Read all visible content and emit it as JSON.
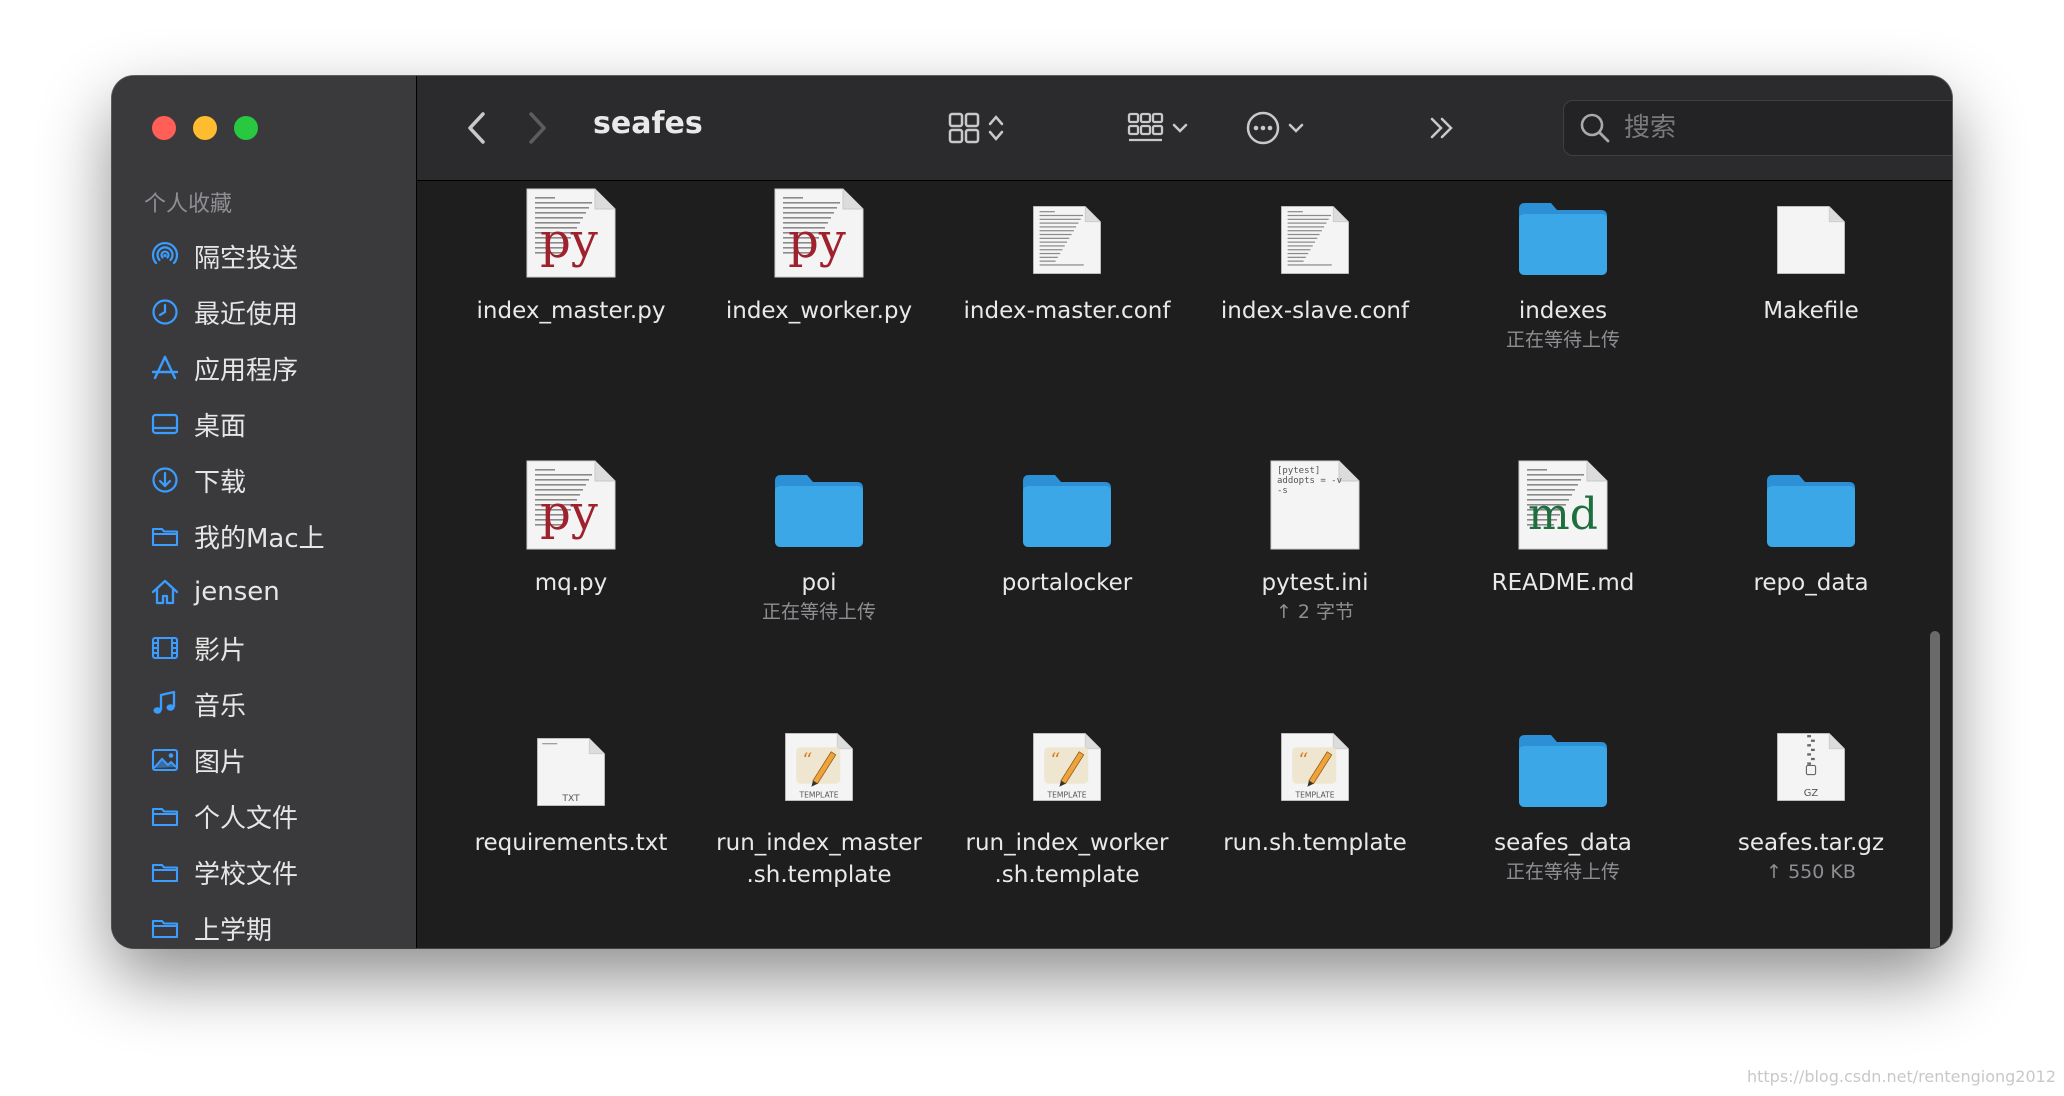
{
  "window": {
    "title": "seafes"
  },
  "sidebar": {
    "section": "个人收藏",
    "items": [
      {
        "label": "隔空投送",
        "icon": "airdrop-icon"
      },
      {
        "label": "最近使用",
        "icon": "clock-icon"
      },
      {
        "label": "应用程序",
        "icon": "applications-icon"
      },
      {
        "label": "桌面",
        "icon": "desktop-icon"
      },
      {
        "label": "下载",
        "icon": "download-icon"
      },
      {
        "label": "我的Mac上",
        "icon": "folder-icon"
      },
      {
        "label": "jensen",
        "icon": "home-icon"
      },
      {
        "label": "影片",
        "icon": "film-icon"
      },
      {
        "label": "音乐",
        "icon": "music-icon"
      },
      {
        "label": "图片",
        "icon": "photo-icon"
      },
      {
        "label": "个人文件",
        "icon": "folder-icon"
      },
      {
        "label": "学校文件",
        "icon": "folder-icon"
      },
      {
        "label": "上学期",
        "icon": "folder-icon"
      }
    ]
  },
  "toolbar": {
    "search_placeholder": "搜索"
  },
  "files": [
    {
      "name": "index_master.py",
      "sub": "",
      "type": "py"
    },
    {
      "name": "index_worker.py",
      "sub": "",
      "type": "py"
    },
    {
      "name": "index-master.conf",
      "sub": "",
      "type": "text"
    },
    {
      "name": "index-slave.conf",
      "sub": "",
      "type": "text"
    },
    {
      "name": "indexes",
      "sub": "正在等待上传",
      "type": "folder"
    },
    {
      "name": "Makefile",
      "sub": "",
      "type": "blank"
    },
    {
      "name": "mq.py",
      "sub": "",
      "type": "py"
    },
    {
      "name": "poi",
      "sub": "正在等待上传",
      "type": "folder"
    },
    {
      "name": "portalocker",
      "sub": "",
      "type": "folder"
    },
    {
      "name": "pytest.ini",
      "sub": "↑ 2 字节",
      "type": "ini"
    },
    {
      "name": "README.md",
      "sub": "",
      "type": "md"
    },
    {
      "name": "repo_data",
      "sub": "",
      "type": "folder"
    },
    {
      "name": "requirements.txt",
      "sub": "",
      "type": "txt"
    },
    {
      "name": "run_index_master\n.sh.template",
      "sub": "",
      "type": "template"
    },
    {
      "name": "run_index_worker\n.sh.template",
      "sub": "",
      "type": "template"
    },
    {
      "name": "run.sh.template",
      "sub": "",
      "type": "template"
    },
    {
      "name": "seafes_data",
      "sub": "正在等待上传",
      "type": "folder"
    },
    {
      "name": "seafes.tar.gz",
      "sub": "↑ 550 KB",
      "type": "gz"
    }
  ],
  "icon_labels": {
    "py": "py",
    "md": "md",
    "txt": "TXT",
    "template": "TEMPLATE",
    "gz": "GZ",
    "ini_text": "[pytest]\naddopts = -v\n-s"
  },
  "colors": {
    "folder": "#3ba7e6",
    "py": "#a0212e",
    "md": "#1f6e3f"
  },
  "watermark": "https://blog.csdn.net/rentengiong2012"
}
